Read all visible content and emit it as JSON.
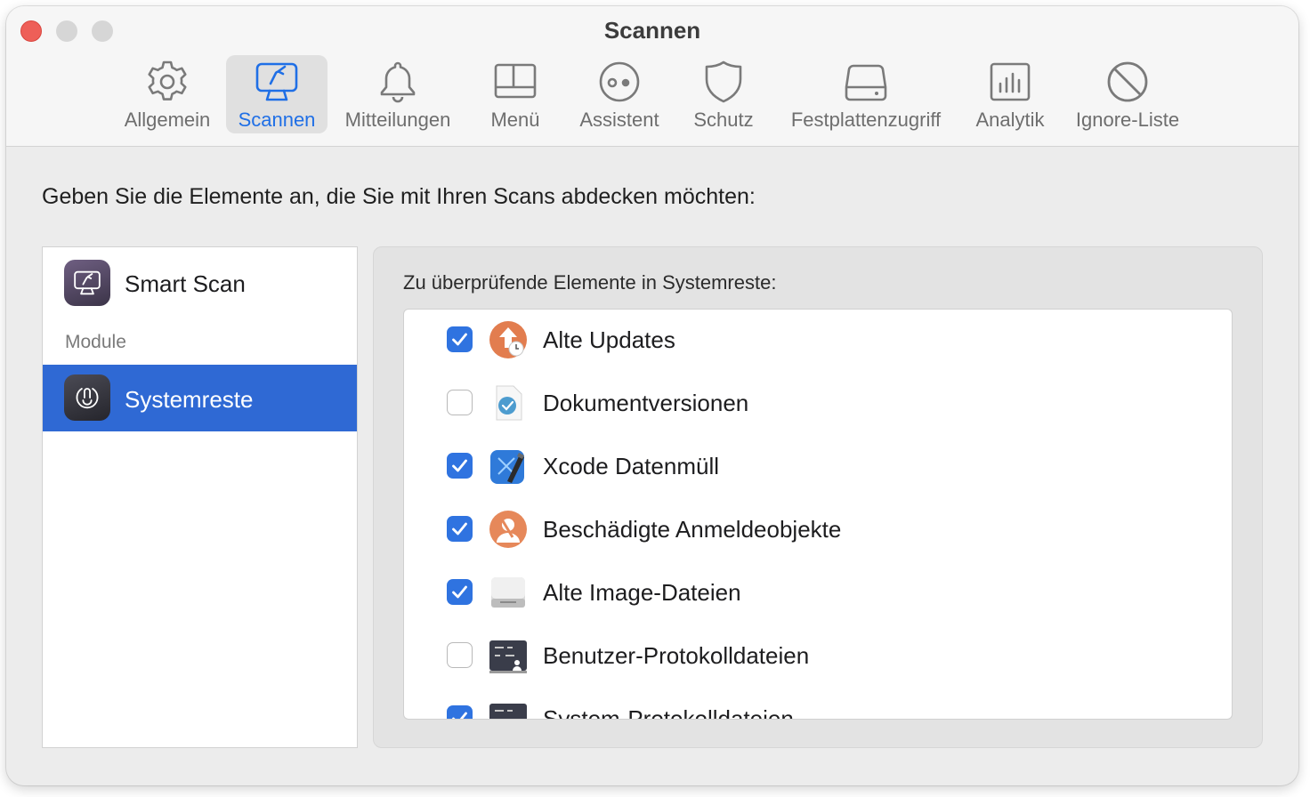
{
  "window": {
    "title": "Scannen"
  },
  "toolbar": {
    "tabs": [
      {
        "label": "Allgemein",
        "icon": "gear-icon"
      },
      {
        "label": "Scannen",
        "icon": "monitor-scan-icon",
        "active": true
      },
      {
        "label": "Mitteilungen",
        "icon": "bell-icon"
      },
      {
        "label": "Menü",
        "icon": "menu-window-icon"
      },
      {
        "label": "Assistent",
        "icon": "assistant-face-icon"
      },
      {
        "label": "Schutz",
        "icon": "shield-icon"
      },
      {
        "label": "Festplattenzugriff",
        "icon": "disk-drive-icon"
      },
      {
        "label": "Analytik",
        "icon": "bar-chart-icon"
      },
      {
        "label": "Ignore-Liste",
        "icon": "prohibited-icon"
      }
    ]
  },
  "main": {
    "instruction": "Geben Sie die Elemente an, die Sie mit Ihren Scans abdecken möchten:"
  },
  "sidebar": {
    "smart_scan": "Smart Scan",
    "module_header": "Module",
    "selected_item": "Systemreste"
  },
  "detail": {
    "heading": "Zu überprüfende Elemente in Systemreste:",
    "items": [
      {
        "label": "Alte Updates",
        "checked": true,
        "icon": "old-updates-icon"
      },
      {
        "label": "Dokumentversionen",
        "checked": false,
        "icon": "document-versions-icon"
      },
      {
        "label": "Xcode Datenmüll",
        "checked": true,
        "icon": "xcode-icon"
      },
      {
        "label": "Beschädigte Anmeldeobjekte",
        "checked": true,
        "icon": "broken-login-items-icon"
      },
      {
        "label": "Alte Image-Dateien",
        "checked": true,
        "icon": "disk-image-icon"
      },
      {
        "label": "Benutzer-Protokolldateien",
        "checked": false,
        "icon": "user-log-files-icon"
      },
      {
        "label": "System-Protokolldateien",
        "checked": true,
        "icon": "system-log-files-icon"
      }
    ]
  },
  "colors": {
    "accent": "#2f73e0",
    "selection": "#2f69d4",
    "close_button": "#ee5f58"
  }
}
